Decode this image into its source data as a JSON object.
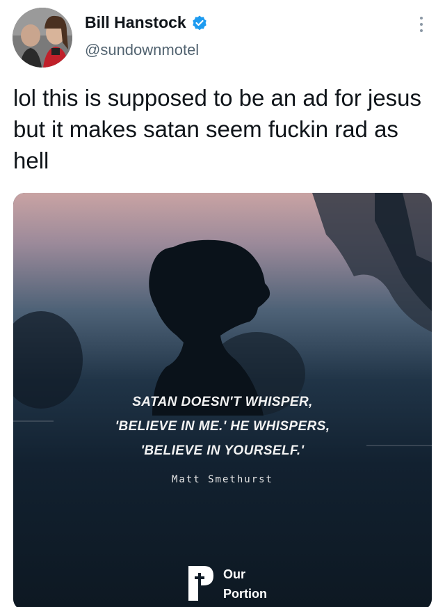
{
  "tweet": {
    "author": {
      "display_name": "Bill Hanstock",
      "handle": "@sundownmotel",
      "verified": true
    },
    "text": "lol this is supposed to be an ad for jesus but it makes satan seem fuckin rad as hell",
    "media": {
      "quote_lines": [
        "SATAN DOESN'T WHISPER,",
        "'BELIEVE IN ME.' HE WHISPERS,",
        "'BELIEVE IN YOURSELF.'"
      ],
      "attribution": "Matt Smethurst",
      "brand": {
        "line1": "Our",
        "line2": "Portion"
      }
    }
  },
  "colors": {
    "verified_badge": "#1d9bf0",
    "handle_text": "#536471",
    "media_bg": "#0f1b26"
  }
}
